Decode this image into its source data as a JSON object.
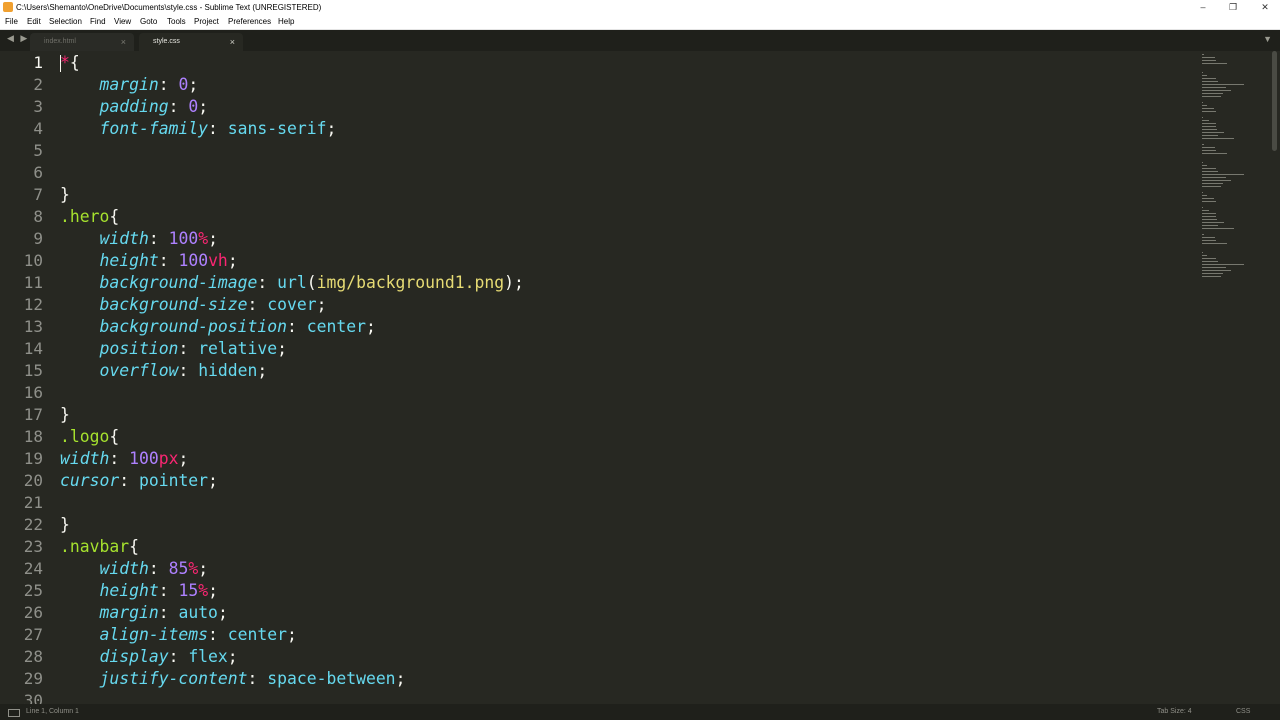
{
  "window": {
    "title": "C:\\Users\\Shemanto\\OneDrive\\Documents\\style.css - Sublime Text (UNREGISTERED)",
    "minimize": "–",
    "maximize": "❐",
    "close": "✕"
  },
  "menu": [
    "File",
    "Edit",
    "Selection",
    "Find",
    "View",
    "Goto",
    "Tools",
    "Project",
    "Preferences",
    "Help"
  ],
  "nav_arrows": "◀ ▶",
  "tabs": [
    {
      "label": "index.html",
      "close": "×",
      "active": false
    },
    {
      "label": "style.css",
      "close": "×",
      "active": true
    }
  ],
  "tab_menu": "▼",
  "editor": {
    "current_line": 1,
    "lines": [
      {
        "n": "1",
        "t": [
          [
            "uni",
            "*"
          ],
          [
            "punc",
            "{"
          ]
        ]
      },
      {
        "n": "2",
        "t": [
          [
            "punc",
            "    "
          ],
          [
            "prop",
            "margin"
          ],
          [
            "punc",
            ": "
          ],
          [
            "num",
            "0"
          ],
          [
            "punc",
            ";"
          ]
        ]
      },
      {
        "n": "3",
        "t": [
          [
            "punc",
            "    "
          ],
          [
            "prop",
            "padding"
          ],
          [
            "punc",
            ": "
          ],
          [
            "num",
            "0"
          ],
          [
            "punc",
            ";"
          ]
        ]
      },
      {
        "n": "4",
        "t": [
          [
            "punc",
            "    "
          ],
          [
            "prop",
            "font-family"
          ],
          [
            "punc",
            ": "
          ],
          [
            "kw",
            "sans-serif"
          ],
          [
            "punc",
            ";"
          ]
        ]
      },
      {
        "n": "5",
        "t": []
      },
      {
        "n": "6",
        "t": []
      },
      {
        "n": "7",
        "t": [
          [
            "punc",
            "}"
          ]
        ]
      },
      {
        "n": "8",
        "t": [
          [
            "sel",
            ".hero"
          ],
          [
            "punc",
            "{"
          ]
        ]
      },
      {
        "n": "9",
        "t": [
          [
            "punc",
            "    "
          ],
          [
            "prop",
            "width"
          ],
          [
            "punc",
            ": "
          ],
          [
            "num",
            "100"
          ],
          [
            "unit",
            "%"
          ],
          [
            "punc",
            ";"
          ]
        ]
      },
      {
        "n": "10",
        "t": [
          [
            "punc",
            "    "
          ],
          [
            "prop",
            "height"
          ],
          [
            "punc",
            ": "
          ],
          [
            "num",
            "100"
          ],
          [
            "unit",
            "vh"
          ],
          [
            "punc",
            ";"
          ]
        ]
      },
      {
        "n": "11",
        "t": [
          [
            "punc",
            "    "
          ],
          [
            "prop",
            "background-image"
          ],
          [
            "punc",
            ": "
          ],
          [
            "kw",
            "url"
          ],
          [
            "punc",
            "("
          ],
          [
            "val",
            "img/background1.png"
          ],
          [
            "punc",
            ");"
          ]
        ]
      },
      {
        "n": "12",
        "t": [
          [
            "punc",
            "    "
          ],
          [
            "prop",
            "background-size"
          ],
          [
            "punc",
            ": "
          ],
          [
            "kw",
            "cover"
          ],
          [
            "punc",
            ";"
          ]
        ]
      },
      {
        "n": "13",
        "t": [
          [
            "punc",
            "    "
          ],
          [
            "prop",
            "background-position"
          ],
          [
            "punc",
            ": "
          ],
          [
            "kw",
            "center"
          ],
          [
            "punc",
            ";"
          ]
        ]
      },
      {
        "n": "14",
        "t": [
          [
            "punc",
            "    "
          ],
          [
            "prop",
            "position"
          ],
          [
            "punc",
            ": "
          ],
          [
            "kw",
            "relative"
          ],
          [
            "punc",
            ";"
          ]
        ]
      },
      {
        "n": "15",
        "t": [
          [
            "punc",
            "    "
          ],
          [
            "prop",
            "overflow"
          ],
          [
            "punc",
            ": "
          ],
          [
            "kw",
            "hidden"
          ],
          [
            "punc",
            ";"
          ]
        ]
      },
      {
        "n": "16",
        "t": []
      },
      {
        "n": "17",
        "t": [
          [
            "punc",
            "}"
          ]
        ]
      },
      {
        "n": "18",
        "t": [
          [
            "sel",
            ".logo"
          ],
          [
            "punc",
            "{"
          ]
        ]
      },
      {
        "n": "19",
        "t": [
          [
            "prop",
            "width"
          ],
          [
            "punc",
            ": "
          ],
          [
            "num",
            "100"
          ],
          [
            "unit",
            "px"
          ],
          [
            "punc",
            ";"
          ]
        ]
      },
      {
        "n": "20",
        "t": [
          [
            "prop",
            "cursor"
          ],
          [
            "punc",
            ": "
          ],
          [
            "kw",
            "pointer"
          ],
          [
            "punc",
            ";"
          ]
        ]
      },
      {
        "n": "21",
        "t": []
      },
      {
        "n": "22",
        "t": [
          [
            "punc",
            "}"
          ]
        ]
      },
      {
        "n": "23",
        "t": [
          [
            "sel",
            ".navbar"
          ],
          [
            "punc",
            "{"
          ]
        ]
      },
      {
        "n": "24",
        "t": [
          [
            "punc",
            "    "
          ],
          [
            "prop",
            "width"
          ],
          [
            "punc",
            ": "
          ],
          [
            "num",
            "85"
          ],
          [
            "unit",
            "%"
          ],
          [
            "punc",
            ";"
          ]
        ]
      },
      {
        "n": "25",
        "t": [
          [
            "punc",
            "    "
          ],
          [
            "prop",
            "height"
          ],
          [
            "punc",
            ": "
          ],
          [
            "num",
            "15"
          ],
          [
            "unit",
            "%"
          ],
          [
            "punc",
            ";"
          ]
        ]
      },
      {
        "n": "26",
        "t": [
          [
            "punc",
            "    "
          ],
          [
            "prop",
            "margin"
          ],
          [
            "punc",
            ": "
          ],
          [
            "kw",
            "auto"
          ],
          [
            "punc",
            ";"
          ]
        ]
      },
      {
        "n": "27",
        "t": [
          [
            "punc",
            "    "
          ],
          [
            "prop",
            "align-items"
          ],
          [
            "punc",
            ": "
          ],
          [
            "kw",
            "center"
          ],
          [
            "punc",
            ";"
          ]
        ]
      },
      {
        "n": "28",
        "t": [
          [
            "punc",
            "    "
          ],
          [
            "prop",
            "display"
          ],
          [
            "punc",
            ": "
          ],
          [
            "kw",
            "flex"
          ],
          [
            "punc",
            ";"
          ]
        ]
      },
      {
        "n": "29",
        "t": [
          [
            "punc",
            "    "
          ],
          [
            "prop",
            "justify-content"
          ],
          [
            "punc",
            ": "
          ],
          [
            "kw",
            "space-between"
          ],
          [
            "punc",
            ";"
          ]
        ]
      },
      {
        "n": "30",
        "t": []
      }
    ]
  },
  "status": {
    "position": "Line 1, Column 1",
    "tab_size": "Tab Size: 4",
    "syntax": "CSS"
  },
  "colors": {
    "background": "#272822",
    "property": "#66d9ef",
    "number": "#ae81ff",
    "unit": "#f92672",
    "selector": "#a6e22e",
    "string": "#e6db74"
  }
}
